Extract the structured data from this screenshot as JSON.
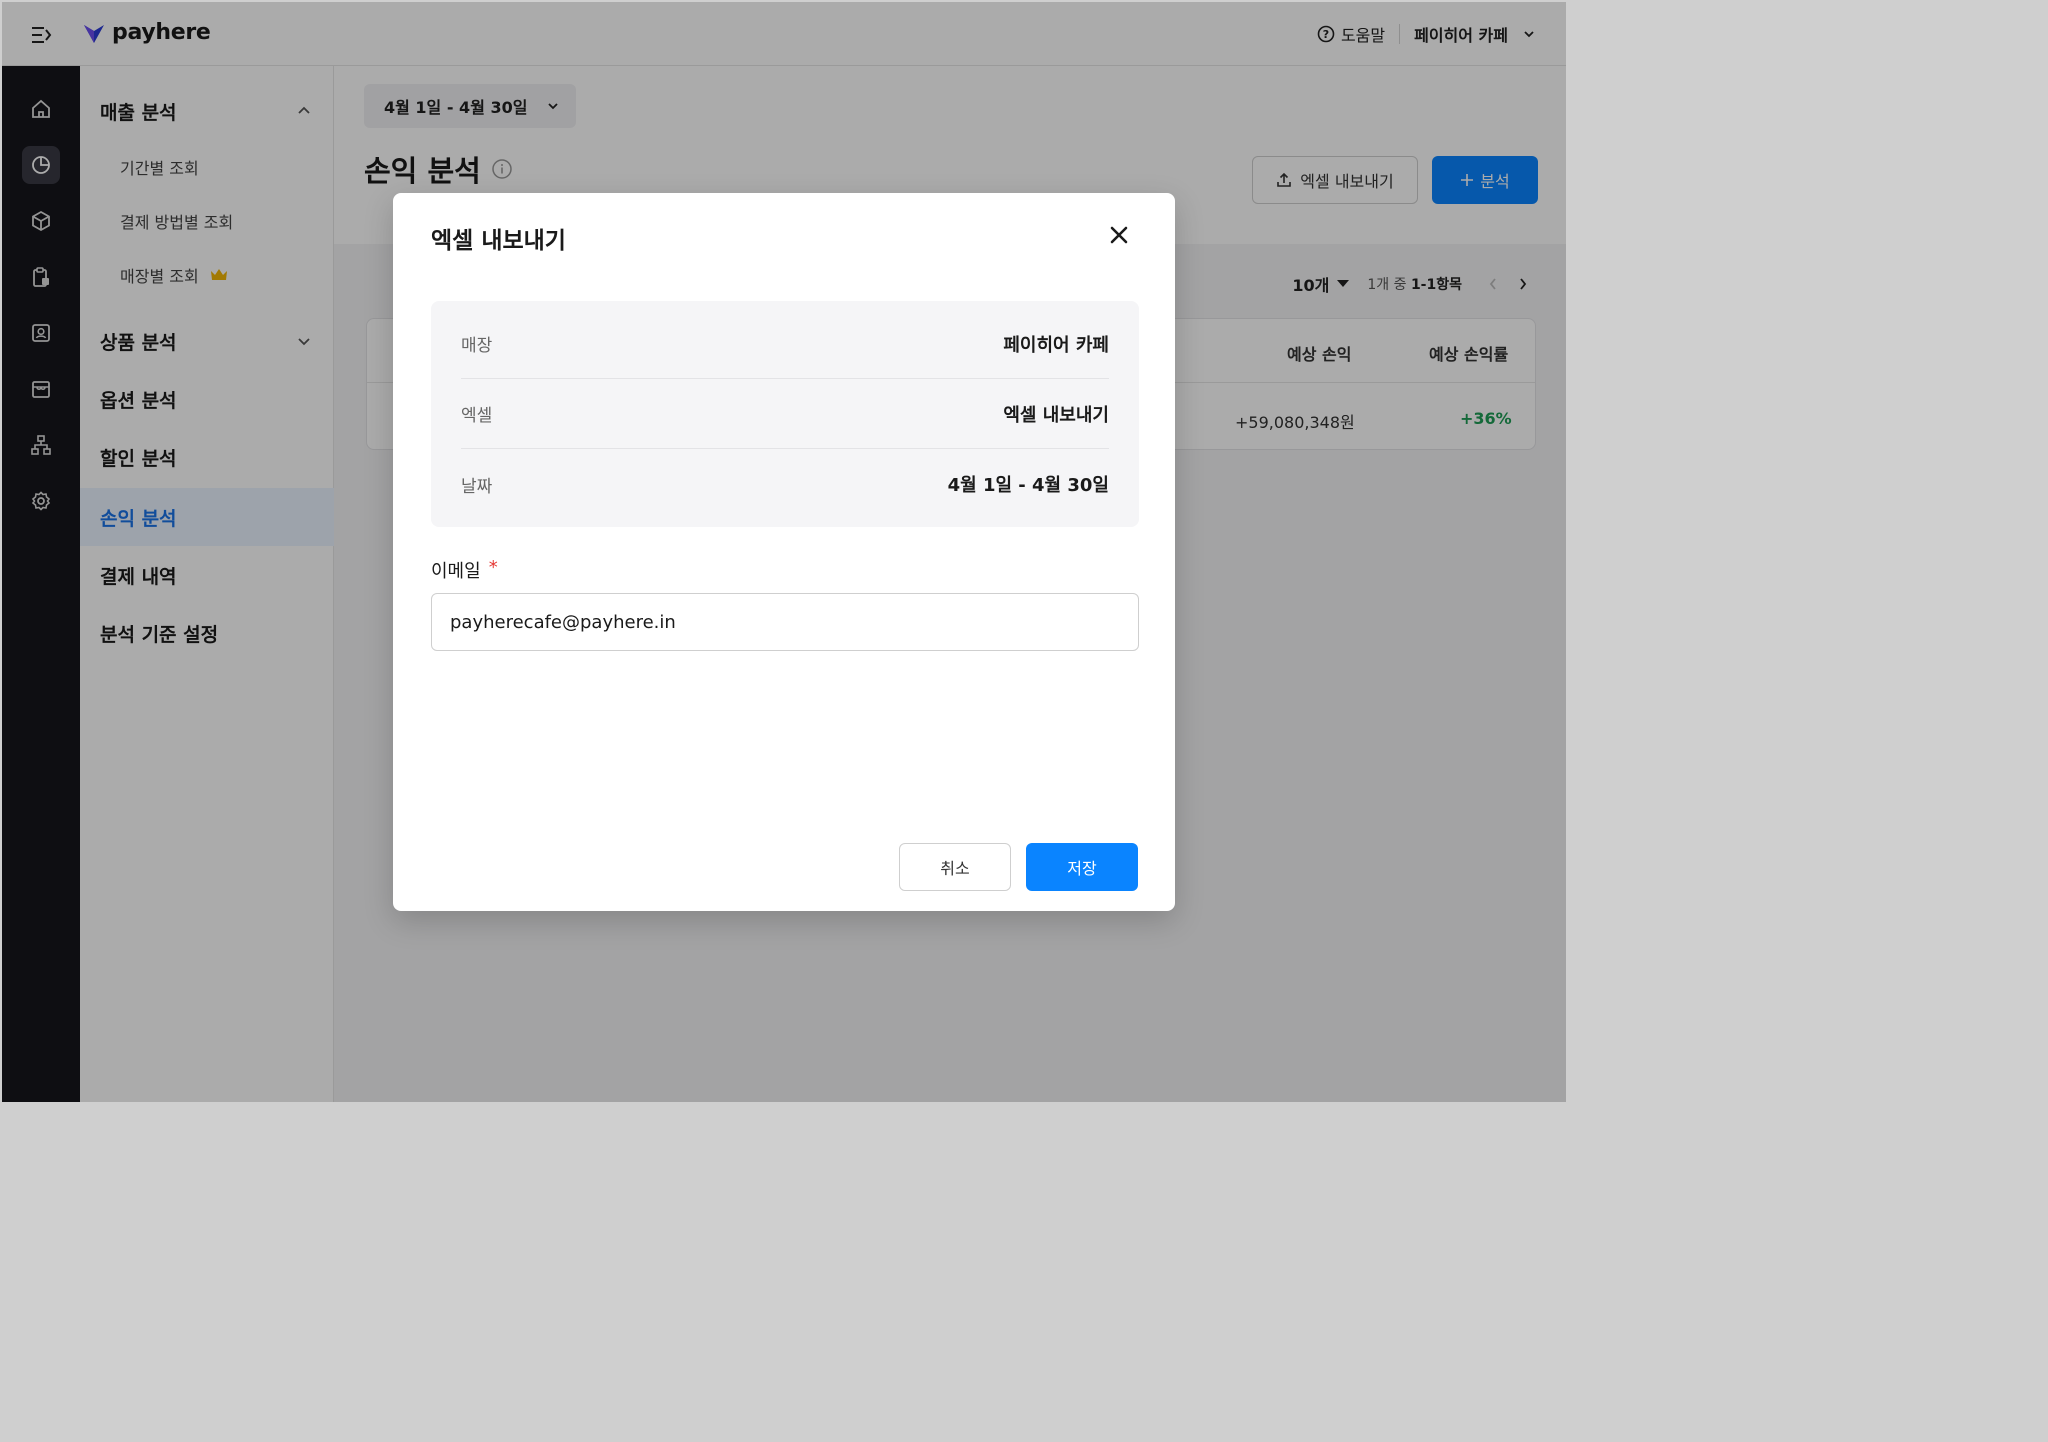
{
  "app": {
    "logo_text": "payhere",
    "help_label": "도움말",
    "store_name": "페이히어 카페"
  },
  "rail": {
    "items": [
      {
        "icon": "home-icon"
      },
      {
        "icon": "pie-chart-icon",
        "active": true
      },
      {
        "icon": "box-icon"
      },
      {
        "icon": "clipboard-icon"
      },
      {
        "icon": "contact-icon"
      },
      {
        "icon": "store-icon"
      },
      {
        "icon": "org-chart-icon"
      },
      {
        "icon": "gear-icon"
      }
    ]
  },
  "sidebar": {
    "sales_analysis": "매출 분석",
    "sub_items": [
      "기간별 조회",
      "결제 방법별 조회",
      "매장별 조회"
    ],
    "product_analysis": "상품 분석",
    "option_analysis": "옵션 분석",
    "discount_analysis": "할인 분석",
    "profit_analysis": "손익 분석",
    "payment_history": "결제 내역",
    "analysis_settings": "분석 기준 설정"
  },
  "main": {
    "date_range": "4월 1일 - 4월 30일",
    "title": "손익 분석",
    "export_label": "엑셀 내보내기",
    "add_label": "분석",
    "page_size": "10개",
    "page_info_prefix": "1개 중",
    "page_info_range": "1-1항목",
    "table": {
      "headers": [
        "예상 손익",
        "예상 손익률"
      ],
      "row": {
        "profit": "+59,080,348원",
        "rate": "+36%"
      }
    }
  },
  "modal": {
    "title": "엑셀 내보내기",
    "rows": [
      {
        "label": "매장",
        "value": "페이히어 카페"
      },
      {
        "label": "엑셀",
        "value": "엑셀 내보내기"
      },
      {
        "label": "날짜",
        "value": "4월 1일 - 4월 30일"
      }
    ],
    "email_label": "이메일",
    "required_mark": "*",
    "email_value": "payherecafe@payhere.in",
    "cancel_label": "취소",
    "save_label": "저장"
  },
  "colors": {
    "accent": "#0a84ff",
    "rail_bg": "#16161c",
    "positive": "#1f9d55",
    "crown": "#f2b705"
  }
}
